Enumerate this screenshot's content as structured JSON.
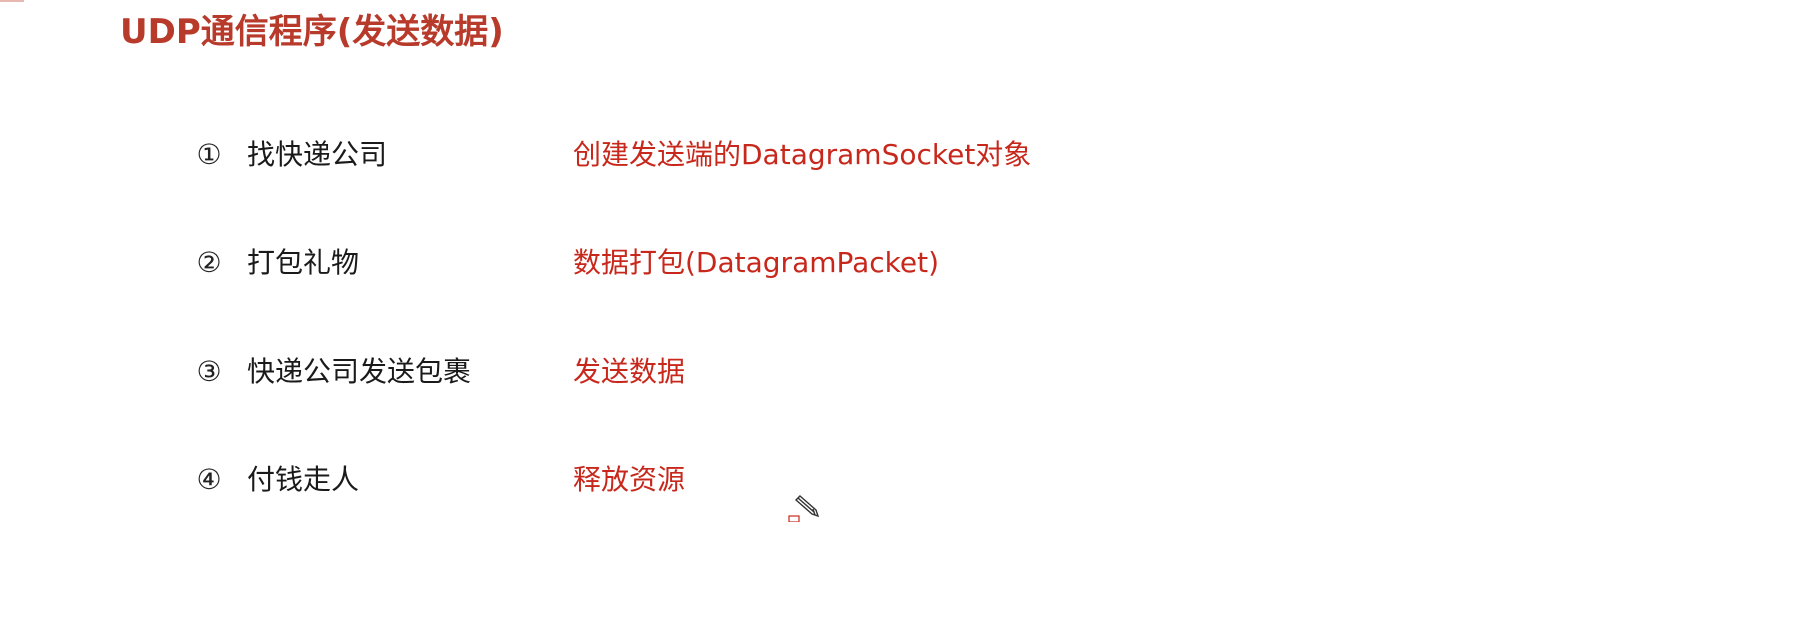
{
  "slide": {
    "title": "UDP通信程序(发送数据)",
    "steps": [
      {
        "num": "①",
        "label": "找快递公司",
        "desc": "创建发送端的DatagramSocket对象"
      },
      {
        "num": "②",
        "label": "打包礼物",
        "desc": "数据打包(DatagramPacket)"
      },
      {
        "num": "③",
        "label": "快递公司发送包裹",
        "desc": "发送数据"
      },
      {
        "num": "④",
        "label": "付钱走人",
        "desc": "释放资源"
      }
    ]
  },
  "colors": {
    "title": "#b83a2b",
    "accent": "#c8281c",
    "text": "#1a1a1a"
  },
  "icons": {
    "cursor": "pencil-cursor-icon"
  }
}
